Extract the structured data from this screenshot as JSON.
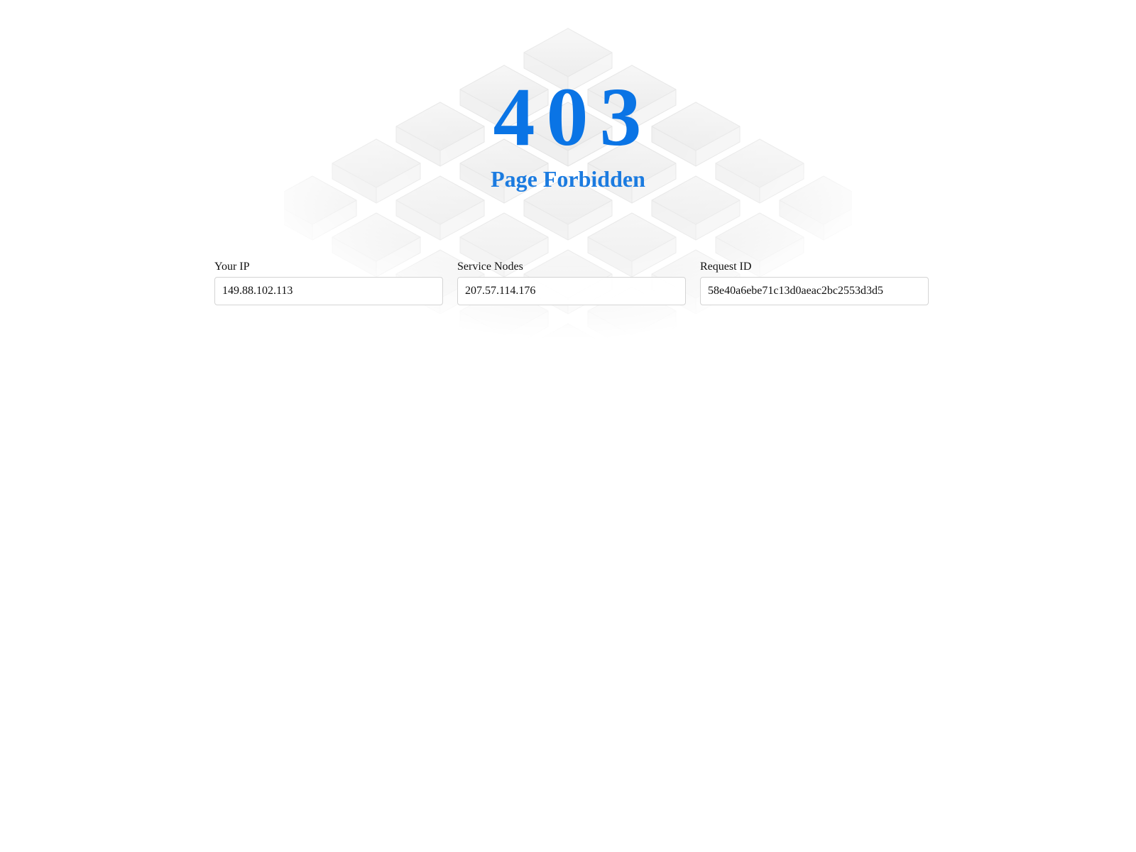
{
  "error": {
    "code": "403",
    "title": "Page Forbidden"
  },
  "fields": [
    {
      "label": "Your IP",
      "value": "149.88.102.113"
    },
    {
      "label": "Service Nodes",
      "value": "207.57.114.176"
    },
    {
      "label": "Request ID",
      "value": "58e40a6ebe71c13d0aeac2bc2553d3d5"
    }
  ],
  "colors": {
    "accent": "#0a74e5",
    "background": "#ffffff",
    "input_border": "#d4d4d4"
  },
  "icons": {
    "background": "isometric-blocks-background"
  }
}
